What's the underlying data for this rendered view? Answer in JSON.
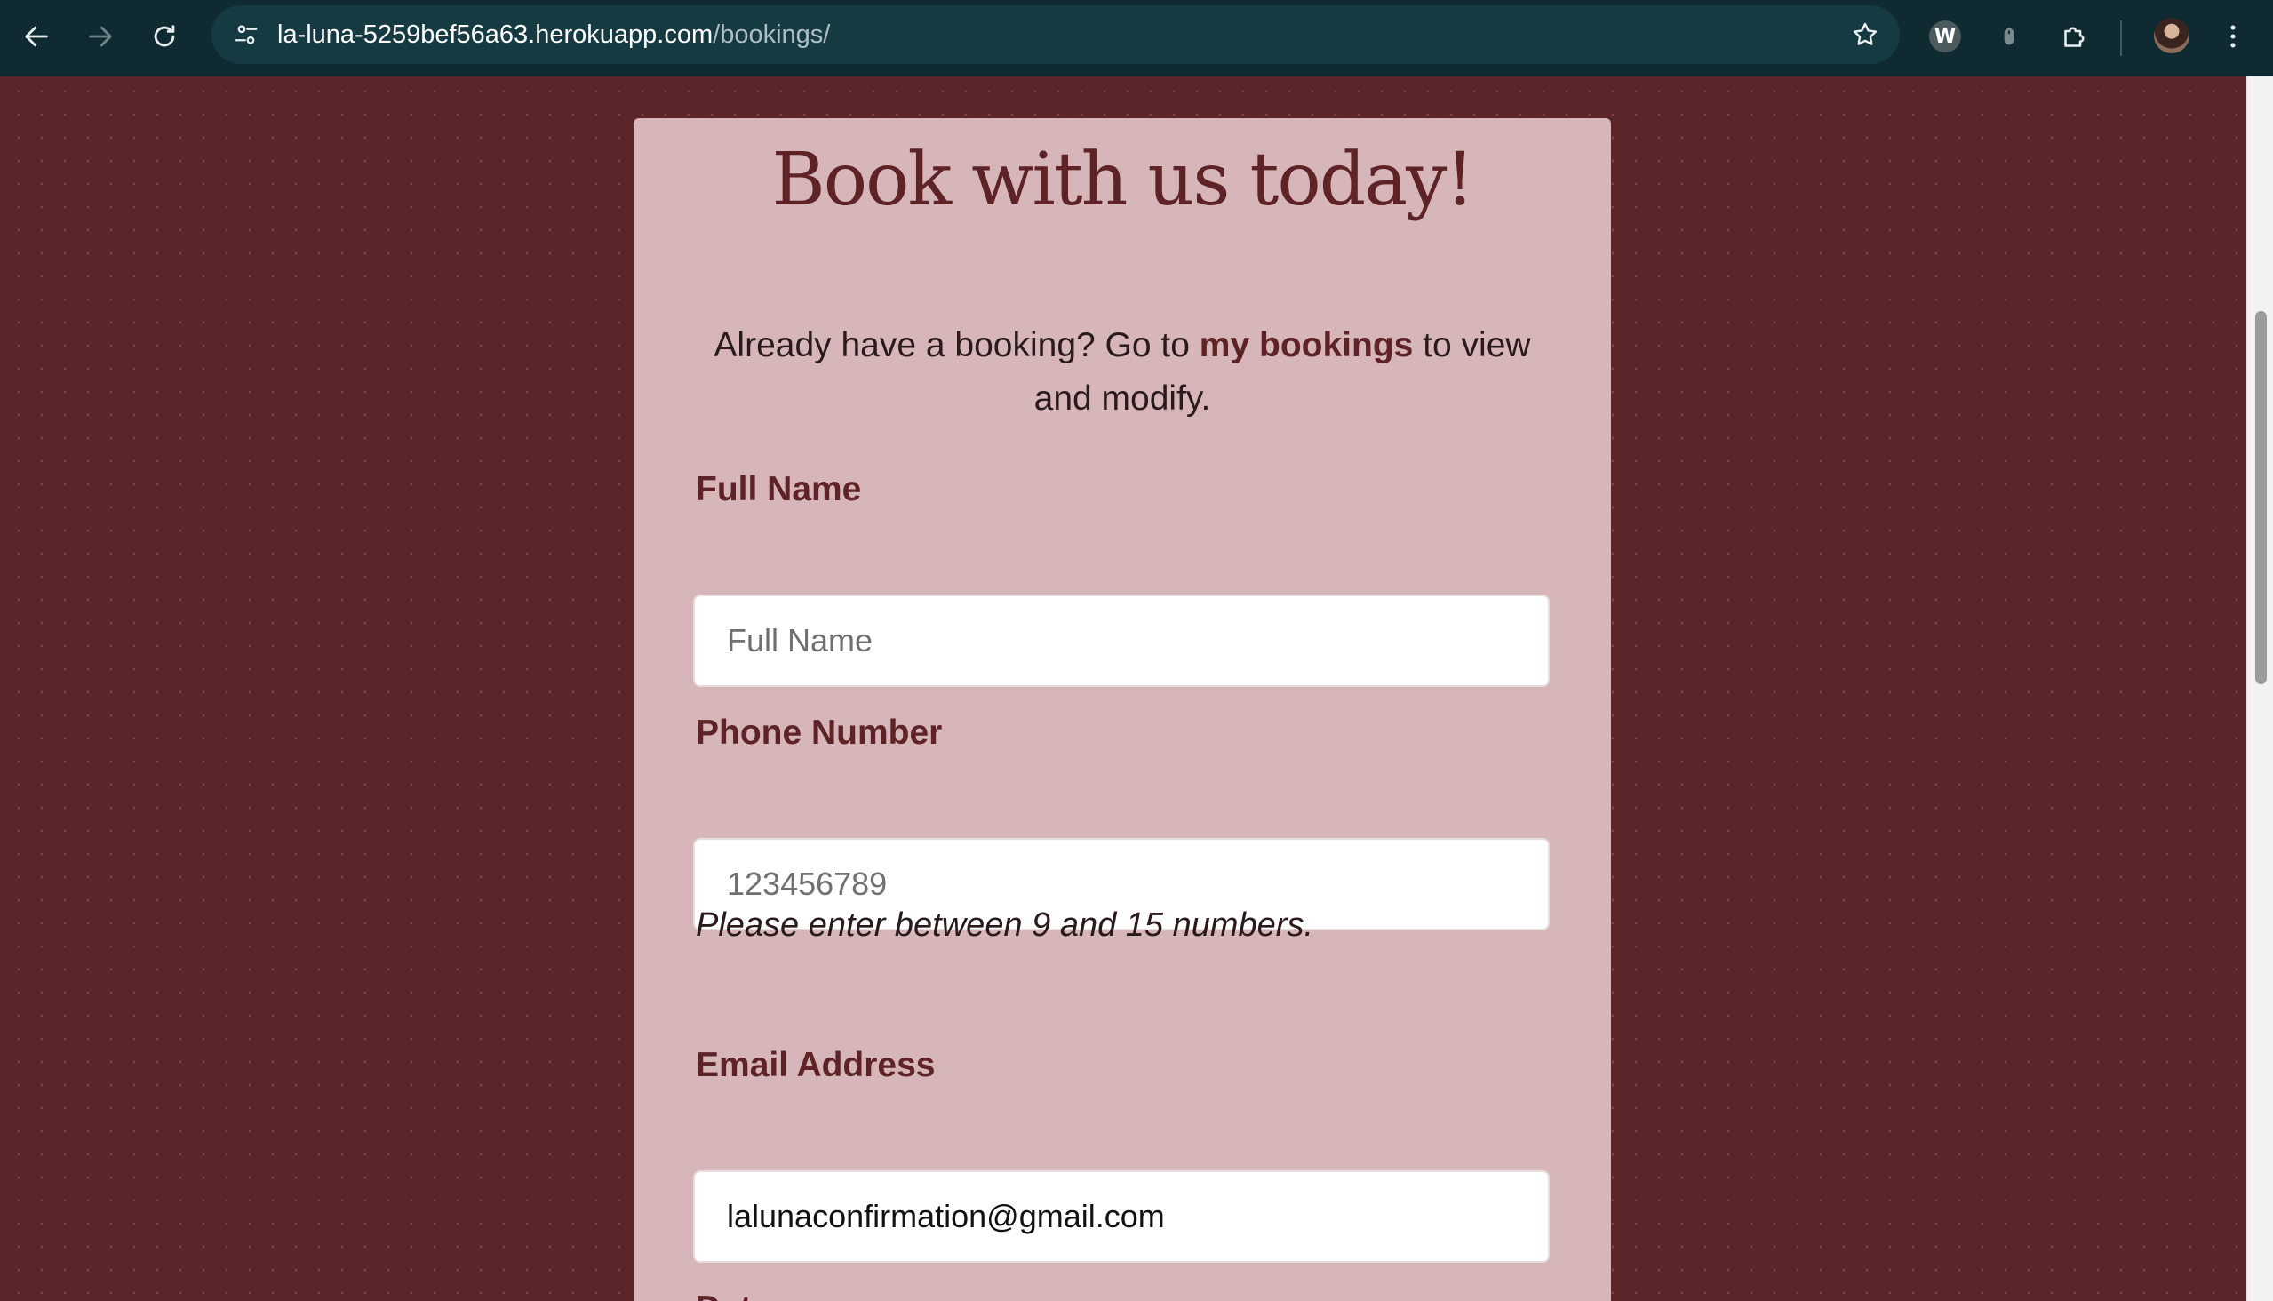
{
  "browser": {
    "url_host": "la-luna-5259bef56a63.herokuapp.com",
    "url_path": "/bookings/",
    "extensions": [
      "w-extension-icon",
      "mouse-extension-icon",
      "puzzle-extensions-icon"
    ]
  },
  "form": {
    "title": "Book with us today!",
    "intro_before": "Already have a booking? Go to ",
    "intro_link": "my bookings",
    "intro_after": " to view and modify.",
    "full_name": {
      "label": "Full Name",
      "placeholder": "Full Name",
      "value": ""
    },
    "phone": {
      "label": "Phone Number",
      "placeholder": "123456789",
      "value": "",
      "help": "Please enter between 9 and 15 numbers."
    },
    "email": {
      "label": "Email Address",
      "value": "lalunaconfirmation@gmail.com"
    },
    "date": {
      "label": "Date"
    }
  },
  "colors": {
    "page_background": "#5a2629",
    "card_background": "#d6b6b8",
    "accent": "#5e2327"
  }
}
